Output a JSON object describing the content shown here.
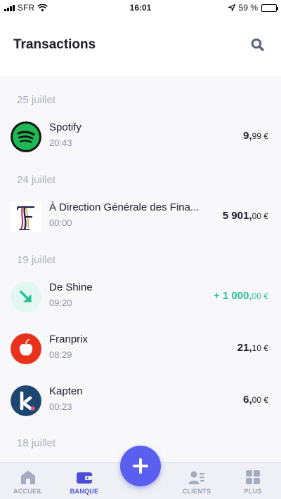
{
  "status_bar": {
    "carrier": "SFR",
    "time": "16:01",
    "battery": "59 %",
    "battery_level": 0.59
  },
  "header": {
    "title": "Transactions"
  },
  "groups": [
    {
      "date": "25 juillet",
      "transactions": [
        {
          "name": "Spotify",
          "time": "20:43",
          "amount_int": "9,",
          "amount_dec": "99 €",
          "type": "debit",
          "logo": "spotify-logo"
        }
      ]
    },
    {
      "date": "24 juillet",
      "transactions": [
        {
          "name": "À Direction Générale des Fina...",
          "time": "00:00",
          "amount_int": "5 901,",
          "amount_dec": "00 €",
          "type": "debit",
          "logo": "dgfip-logo"
        }
      ]
    },
    {
      "date": "19 juillet",
      "transactions": [
        {
          "name": "De Shine",
          "time": "09:20",
          "amount_int": "+ 1 000,",
          "amount_dec": "00 €",
          "type": "credit",
          "logo": "incoming-arrow-icon"
        },
        {
          "name": "Franprix",
          "time": "08:29",
          "amount_int": "21,",
          "amount_dec": "10 €",
          "type": "debit",
          "logo": "franprix-logo"
        },
        {
          "name": "Kapten",
          "time": "00:23",
          "amount_int": "6,",
          "amount_dec": "00 €",
          "type": "debit",
          "logo": "kapten-logo"
        }
      ]
    },
    {
      "date": "18 juillet",
      "transactions": []
    }
  ],
  "tabbar": {
    "items": [
      {
        "label": "ACCUEIL",
        "icon": "home-icon",
        "active": false
      },
      {
        "label": "BANQUE",
        "icon": "wallet-icon",
        "active": true
      },
      {
        "label": "CLIENTS",
        "icon": "clients-icon",
        "active": false
      },
      {
        "label": "PLUS",
        "icon": "grid-icon",
        "active": false
      }
    ],
    "fab_icon": "plus-icon"
  },
  "colors": {
    "accent": "#5b5ff0",
    "credit": "#2bbd96",
    "muted": "#a9adbb"
  }
}
